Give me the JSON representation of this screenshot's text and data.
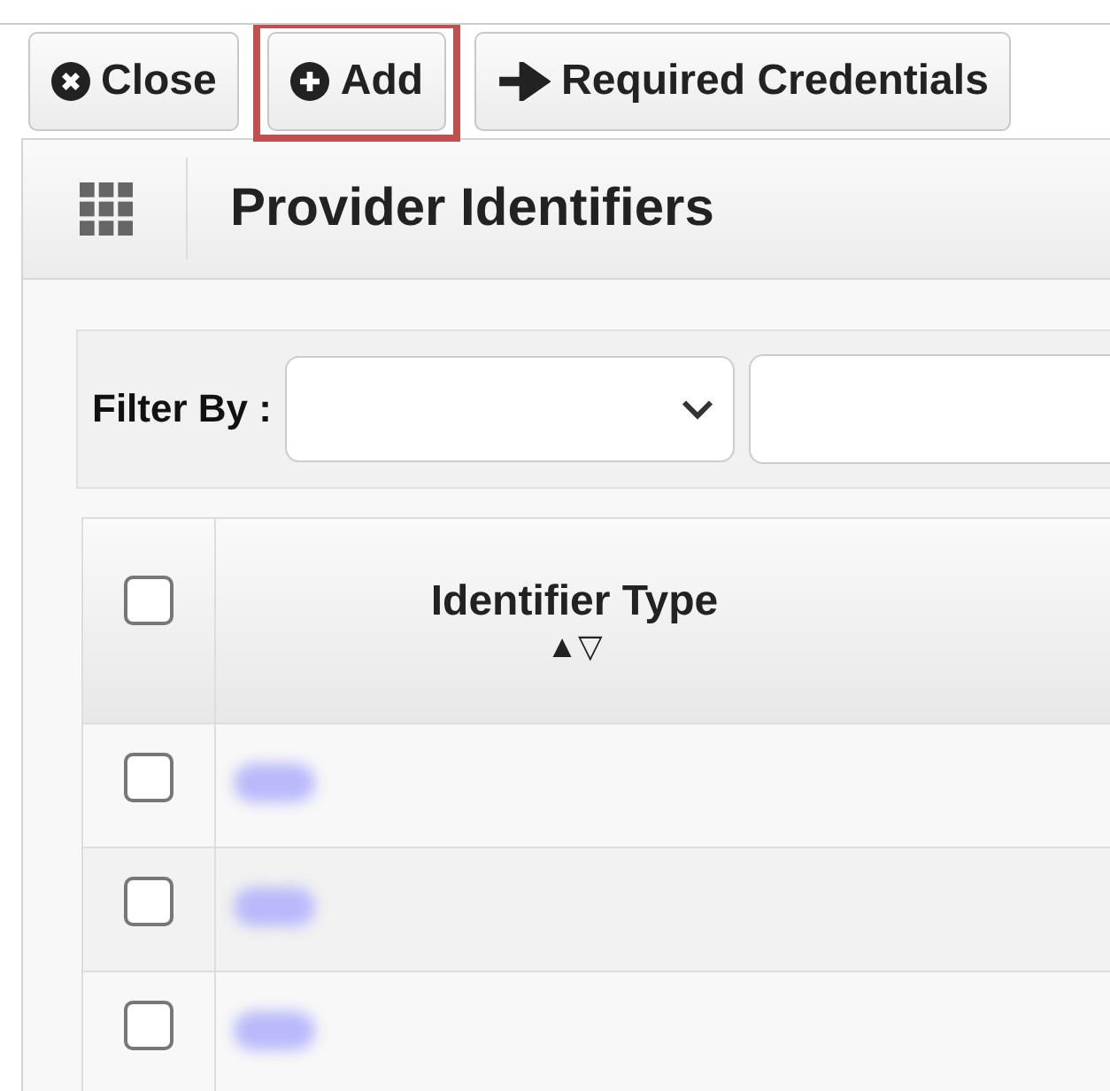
{
  "toolbar": [
    {
      "label": "Close",
      "kind": "close",
      "highlighted": false
    },
    {
      "label": "Add",
      "kind": "add",
      "highlighted": true
    },
    {
      "label": "Required Credentials",
      "kind": "link",
      "highlighted": false
    }
  ],
  "panel": {
    "title": "Provider Identifiers"
  },
  "filter": {
    "label": "Filter By :"
  },
  "table": {
    "header_checked": false,
    "columns": [
      {
        "label": "Identifier Type",
        "sort": "▲▽"
      }
    ],
    "rows": [
      {
        "checked": false,
        "redacted": true
      },
      {
        "checked": false,
        "redacted": true
      },
      {
        "checked": false,
        "redacted": true
      }
    ]
  }
}
